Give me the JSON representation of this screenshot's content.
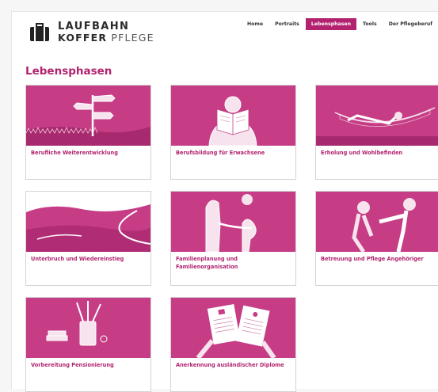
{
  "brand": {
    "line1": "LAUFBAHN",
    "line2_bold": "KOFFER",
    "line2_light": "PFLEGE"
  },
  "nav": {
    "items": [
      "Home",
      "Portraits",
      "Lebensphasen",
      "Tools",
      "Der Pflegeberuf"
    ],
    "active": "Lebensphasen"
  },
  "page_title": "Lebensphasen",
  "cards": [
    {
      "label": "Berufliche Weiterentwicklung",
      "icon": "signpost-icon"
    },
    {
      "label": "Berufsbildung für Erwachsene",
      "icon": "reading-person-icon"
    },
    {
      "label": "Erholung und Wohlbefinden",
      "icon": "hammock-icon"
    },
    {
      "label": "Unterbruch und Wiedereinstieg",
      "icon": "landscape-road-icon"
    },
    {
      "label": "Familienplanung und Familienorganisation",
      "icon": "pregnant-couple-icon"
    },
    {
      "label": "Betreuung und Pflege Angehöriger",
      "icon": "caregiver-icon"
    },
    {
      "label": "Vorbereitung Pensionierung",
      "icon": "pencil-cup-icon"
    },
    {
      "label": "Anerkennung ausländischer Diplome",
      "icon": "diplomas-icon"
    }
  ],
  "colors": {
    "accent": "#b2226f",
    "image_fill": "#c63d86"
  }
}
